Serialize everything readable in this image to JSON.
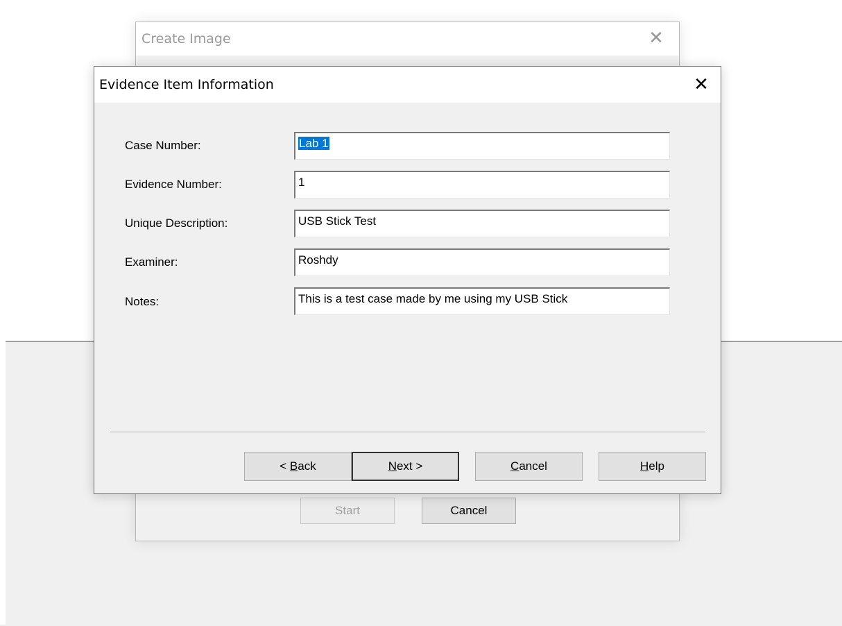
{
  "back_dialog": {
    "title": "Create Image",
    "close_glyph": "✕",
    "start_label": "Start",
    "cancel_label": "Cancel"
  },
  "dialog": {
    "title": "Evidence Item Information",
    "close_glyph": "✕",
    "fields": [
      {
        "label": "Case Number:",
        "value": "Lab 1",
        "selected": true
      },
      {
        "label": "Evidence Number:",
        "value": "1"
      },
      {
        "label": "Unique Description:",
        "value": "USB Stick Test"
      },
      {
        "label": "Examiner:",
        "value": "Roshdy"
      },
      {
        "label": "Notes:",
        "value": "This is a test case made by me using my USB Stick"
      }
    ],
    "buttons": {
      "back": {
        "prefix": "< ",
        "mnemonic": "B",
        "rest": "ack"
      },
      "next": {
        "mnemonic": "N",
        "rest": "ext >"
      },
      "cancel": {
        "mnemonic": "C",
        "rest": "ancel"
      },
      "help": {
        "mnemonic": "H",
        "rest": "elp"
      }
    }
  }
}
